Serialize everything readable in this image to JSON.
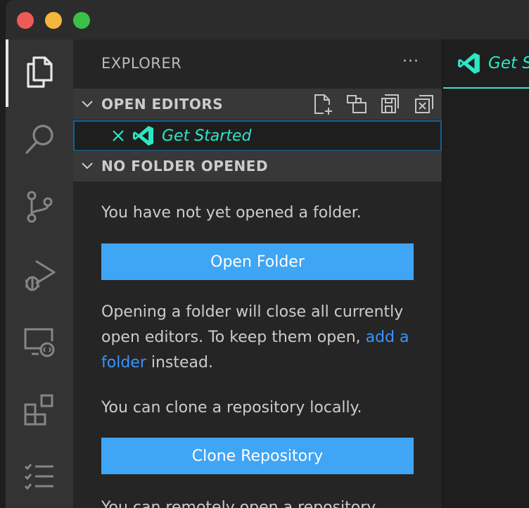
{
  "window": {
    "traffic_lights": [
      "close",
      "minimize",
      "maximize"
    ]
  },
  "activity_bar": {
    "items": [
      {
        "icon": "files-icon",
        "active": true
      },
      {
        "icon": "search-icon",
        "active": false
      },
      {
        "icon": "source-control-icon",
        "active": false
      },
      {
        "icon": "run-debug-icon",
        "active": false
      },
      {
        "icon": "remote-explorer-icon",
        "active": false
      },
      {
        "icon": "extensions-icon",
        "active": false
      },
      {
        "icon": "testing-icon",
        "active": false
      }
    ]
  },
  "sidebar": {
    "title": "EXPLORER",
    "more": "···",
    "open_editors": {
      "label": "OPEN EDITORS",
      "actions": [
        "new-file-icon",
        "toggle-layout-icon",
        "save-all-icon",
        "close-all-icon"
      ],
      "items": [
        {
          "name": "Get Started",
          "icon": "vscode-logo-icon"
        }
      ]
    },
    "no_folder": {
      "label": "NO FOLDER OPENED",
      "text1": "You have not yet opened a folder.",
      "open_button": "Open Folder",
      "text2_pre": "Opening a folder will close all currently open editors. To keep them open, ",
      "text2_link": "add a folder",
      "text2_post": " instead.",
      "text3": "You can clone a repository locally.",
      "clone_button": "Clone Repository",
      "text4": "You can remotely open a repository"
    }
  },
  "editor": {
    "tab_title": "Get Started"
  },
  "colors": {
    "accent": "#2ee6c4",
    "button": "#3fa5f5",
    "link": "#3794ff"
  }
}
